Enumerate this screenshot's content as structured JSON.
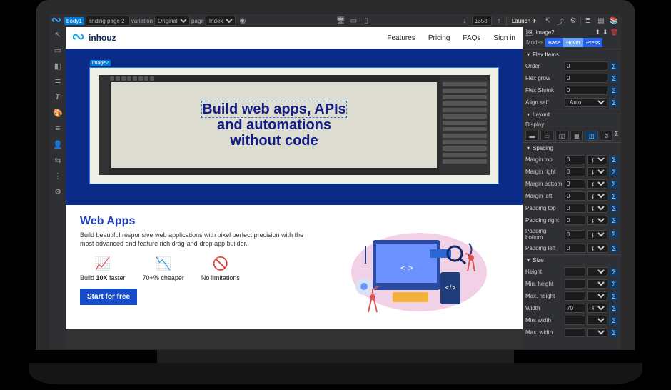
{
  "topbar": {
    "body_tag": "body1",
    "page_field": "anding page 2",
    "variation_label": "variation",
    "variation_value": "Original",
    "page_label": "page",
    "page_value": "Index",
    "scroll_pos": "1353",
    "launch_label": "Launch"
  },
  "site": {
    "brand": "inhouz",
    "nav": {
      "features": "Features",
      "pricing": "Pricing",
      "faqs": "FAQs",
      "signin": "Sign in"
    }
  },
  "hero": {
    "label": "image2",
    "headline_l1": "Build web apps, APIs",
    "headline_l2": "and automations",
    "headline_l3": "without code"
  },
  "webapps": {
    "title": "Web Apps",
    "desc": "Build beautiful responsive web applications with pixel perfect precision with the most advanced and feature rich drag-and-drop app builder.",
    "feat1": "Build <b>10X</b> faster",
    "feat1_plain": "Build 10X faster",
    "feat2": "70+% cheaper",
    "feat3": "No limitations",
    "cta": "Start for free"
  },
  "inspector": {
    "element": "image2",
    "modes_label": "Modes",
    "mode_base": "Base",
    "mode_hover": "Hover",
    "mode_press": "Press",
    "sections": {
      "flex_items": "Flex Items",
      "layout": "Layout",
      "spacing": "Spacing",
      "size": "Size"
    },
    "props": {
      "order": {
        "label": "Order",
        "value": "0"
      },
      "flex_grow": {
        "label": "Flex grow",
        "value": "0"
      },
      "flex_shrink": {
        "label": "Flex Shrink",
        "value": "0"
      },
      "align_self": {
        "label": "Align self",
        "value": "Auto"
      },
      "display": {
        "label": "Display"
      },
      "margin_top": {
        "label": "Margin top",
        "value": "0",
        "unit": "px"
      },
      "margin_right": {
        "label": "Margin right",
        "value": "0",
        "unit": "px"
      },
      "margin_bottom": {
        "label": "Margin bottom",
        "value": "0",
        "unit": "px"
      },
      "margin_left": {
        "label": "Margin left",
        "value": "0",
        "unit": "px"
      },
      "padding_top": {
        "label": "Padding top",
        "value": "0",
        "unit": "px"
      },
      "padding_right": {
        "label": "Padding right",
        "value": "0",
        "unit": "px"
      },
      "padding_bottom": {
        "label": "Padding bottom",
        "value": "0",
        "unit": "px"
      },
      "padding_left": {
        "label": "Padding left",
        "value": "0",
        "unit": "px"
      },
      "height": {
        "label": "Height",
        "value": "",
        "unit": ""
      },
      "min_height": {
        "label": "Min. height",
        "value": "",
        "unit": ""
      },
      "max_height": {
        "label": "Max. height",
        "value": "",
        "unit": ""
      },
      "width": {
        "label": "Width",
        "value": "70",
        "unit": "%"
      },
      "min_width": {
        "label": "Min. width",
        "value": "",
        "unit": ""
      },
      "max_width": {
        "label": "Max. width",
        "value": "",
        "unit": ""
      }
    }
  }
}
